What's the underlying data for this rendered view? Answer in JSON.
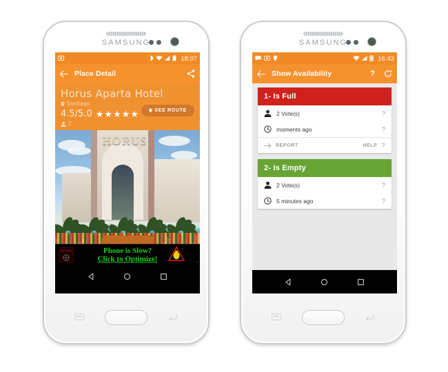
{
  "left_phone": {
    "device_brand": "SAMSUNG",
    "status_bar": {
      "time": "18:07",
      "left_icons": [
        "screenshot-icon"
      ],
      "right_icons": [
        "do-not-disturb-icon",
        "wifi-icon",
        "signal-icon",
        "battery-icon"
      ]
    },
    "app_bar": {
      "back_icon": "back-arrow-icon",
      "title": "Place Detail",
      "share_icon": "share-icon"
    },
    "place": {
      "name": "Horus Aparta Hotel",
      "city": "Santiago",
      "location_icon": "location-pin-icon",
      "rating": "4.5/5.0",
      "stars": 5,
      "see_route_label": "SEE ROUTE",
      "people_icon": "person-icon",
      "people_count": "2",
      "photo_sign_text": "HORUS"
    },
    "ad": {
      "line1": "Phone is Slow?",
      "line2": "Click to Optimize!",
      "badge_label": "AdChoice",
      "warning_icon": "warning-triangle-icon",
      "close_label": "x"
    },
    "nav_bar": {
      "back": "nav-back-icon",
      "home": "nav-home-icon",
      "recents": "nav-recents-icon"
    }
  },
  "right_phone": {
    "device_brand": "SAMSUNG",
    "status_bar": {
      "time": "16:43",
      "left_icons": [
        "chat-bubble-icon",
        "screenshot-icon",
        "location-pin-icon"
      ],
      "right_icons": [
        "wifi-icon",
        "signal-icon",
        "battery-icon"
      ]
    },
    "app_bar": {
      "back_icon": "back-arrow-icon",
      "title": "Show Availability",
      "help_label": "?",
      "refresh_icon": "refresh-icon"
    },
    "cards": [
      {
        "header": "1- Is Full",
        "header_color": "#d0211c",
        "votes_icon": "person-icon",
        "votes": "2 Vote(s)",
        "votes_hint": "?",
        "time_icon": "clock-icon",
        "time": "moments ago",
        "time_hint": "?",
        "report_icon": "arrow-right-icon",
        "report_label": "REPORT",
        "help_label": "HELP",
        "help_hint": "?"
      },
      {
        "header": "2- Is Empty",
        "header_color": "#67a434",
        "votes_icon": "person-icon",
        "votes": "2 Vote(s)",
        "votes_hint": "?",
        "time_icon": "clock-icon",
        "time": "5 minutes ago",
        "time_hint": "?"
      }
    ],
    "nav_bar": {
      "back": "nav-back-icon",
      "home": "nav-home-icon",
      "recents": "nav-recents-icon"
    }
  },
  "colors": {
    "orange_appbar": "#f5922e",
    "orange_status": "#f08a24",
    "red": "#d0211c",
    "green": "#67a434",
    "ad_green_text": "#19d619",
    "page_background": "#e8e8e8"
  }
}
